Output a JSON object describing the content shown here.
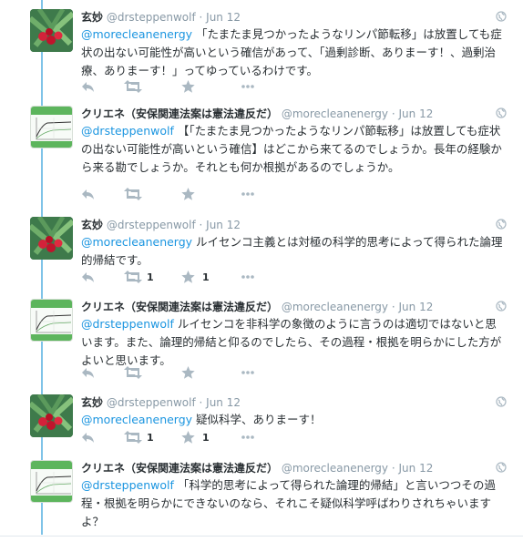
{
  "tweets": [
    {
      "name": "玄妙",
      "handle": "@drsteppenwolf",
      "date": "Jun 12",
      "mention": "@morecleanenergy",
      "body": " 「たまたま見つかったようなリンパ節転移」は放置しても症状の出ない可能性が高いという確信があって、「過剰診断、ありまーす！、過剰治療、ありまーす！」ってゆっているわけです。",
      "retweets": "",
      "favorites": ""
    },
    {
      "name": "クリエネ（安保関連法案は憲法違反だ）",
      "handle": "@morecleanenergy",
      "date": "Jun 12",
      "mention": "@drsteppenwolf",
      "body": " 【「たまたま見つかったようなリンパ節転移」は放置しても症状の出ない可能性が高いという確信】はどこから来てるのでしょうか。長年の経験から来る勘でしょうか。それとも何か根拠があるのでしょうか。",
      "retweets": "",
      "favorites": ""
    },
    {
      "name": "玄妙",
      "handle": "@drsteppenwolf",
      "date": "Jun 12",
      "mention": "@morecleanenergy",
      "body": " ルイセンコ主義とは対極の科学的思考によって得られた論理的帰結です。",
      "retweets": "1",
      "favorites": "1"
    },
    {
      "name": "クリエネ（安保関連法案は憲法違反だ）",
      "handle": "@morecleanenergy",
      "date": "Jun 12",
      "mention": "@drsteppenwolf",
      "body": " ルイセンコを非科学の象徴のように言うのは適切ではないと思います。また、論理的帰結と仰るのでしたら、その過程・根拠を明らかにした方がよいと思います。",
      "retweets": "",
      "favorites": ""
    },
    {
      "name": "玄妙",
      "handle": "@drsteppenwolf",
      "date": "Jun 12",
      "mention": "@morecleanenergy",
      "body": " 疑似科学、ありまーす！",
      "retweets": "1",
      "favorites": "1"
    },
    {
      "name": "クリエネ（安保関連法案は憲法違反だ）",
      "handle": "@morecleanenergy",
      "date": "Jun 12",
      "mention": "@drsteppenwolf",
      "body": " 「科学的思考によって得られた論理的帰結」と言いつつその過程・根拠を明らかにできないのなら、それこそ疑似科学呼ばわりされちゃいますよ？",
      "retweets": "",
      "favorites": ""
    }
  ],
  "separator": "·",
  "icons": [
    "reply-icon",
    "retweet-icon",
    "favorite-icon",
    "more-icon",
    "globe-icon"
  ],
  "colors": {
    "accent": "#1b95e0",
    "meta": "#8899a6",
    "action": "#aab8c2",
    "thread": "#7fc3e8"
  }
}
